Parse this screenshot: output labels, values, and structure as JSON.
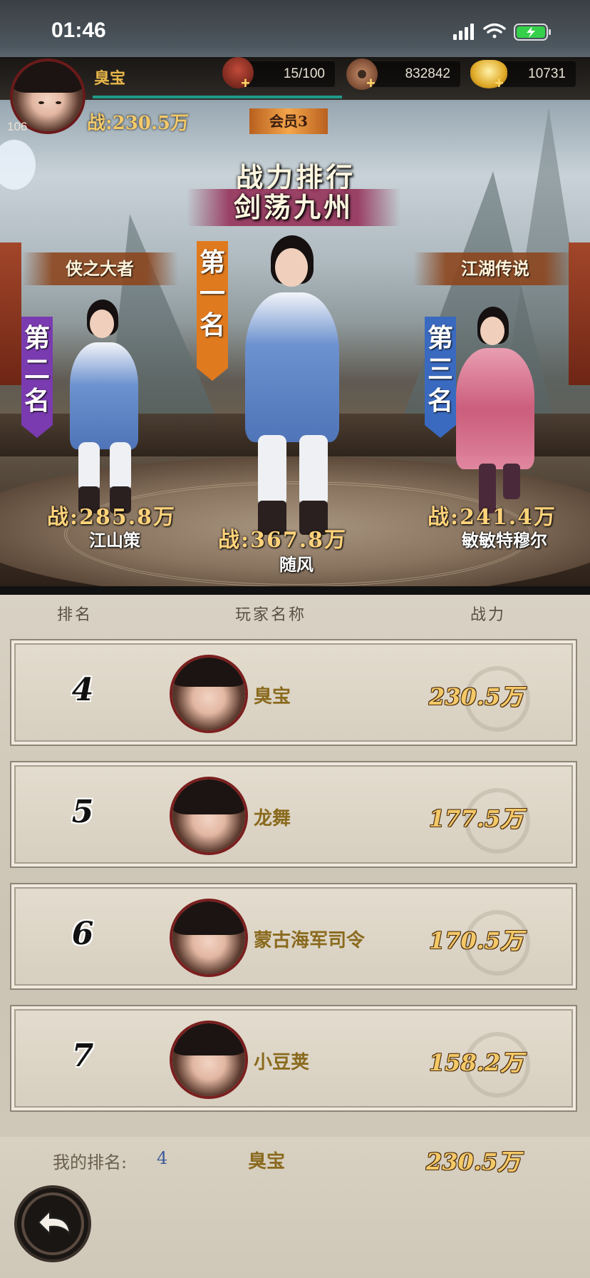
{
  "status_bar": {
    "time": "01:46"
  },
  "player": {
    "name": "臭宝",
    "level": "106",
    "power": "战:230.5万",
    "vip": "会员3"
  },
  "resources": [
    {
      "icon": "wine-jar-icon",
      "value": "15/100"
    },
    {
      "icon": "copper-coin-icon",
      "value": "832842"
    },
    {
      "icon": "gold-ingot-icon",
      "value": "10731"
    }
  ],
  "titles": {
    "main": "战力排行",
    "sub": "剑荡九州"
  },
  "podium": {
    "first": {
      "ribbon": "第一名",
      "name": "随风",
      "power": "战:367.8万"
    },
    "second": {
      "plaque": "侠之大者",
      "ribbon": "第二名",
      "name": "江山策",
      "power": "战:285.8万"
    },
    "third": {
      "plaque": "江湖传说",
      "ribbon": "第三名",
      "name": "敏敏特穆尔",
      "power": "战:241.4万"
    }
  },
  "columns": {
    "rank": "排名",
    "player": "玩家名称",
    "power": "战力"
  },
  "rows": [
    {
      "rank": "4",
      "name": "臭宝",
      "power": "230.5万"
    },
    {
      "rank": "5",
      "name": "龙舞",
      "power": "177.5万"
    },
    {
      "rank": "6",
      "name": "蒙古海军司令",
      "power": "170.5万"
    },
    {
      "rank": "7",
      "name": "小豆荚",
      "power": "158.2万"
    }
  ],
  "footer": {
    "my_rank_label": "我的排名:",
    "my_rank_value": "4",
    "my_name": "臭宝",
    "my_power": "230.5万"
  },
  "colors": {
    "accent_gold": "#f3c867",
    "name_gold": "#8a6a1e",
    "ribbon_orange": "#e07a1f",
    "ribbon_purple": "#7a3bb0",
    "ribbon_blue": "#3a6ac0"
  }
}
